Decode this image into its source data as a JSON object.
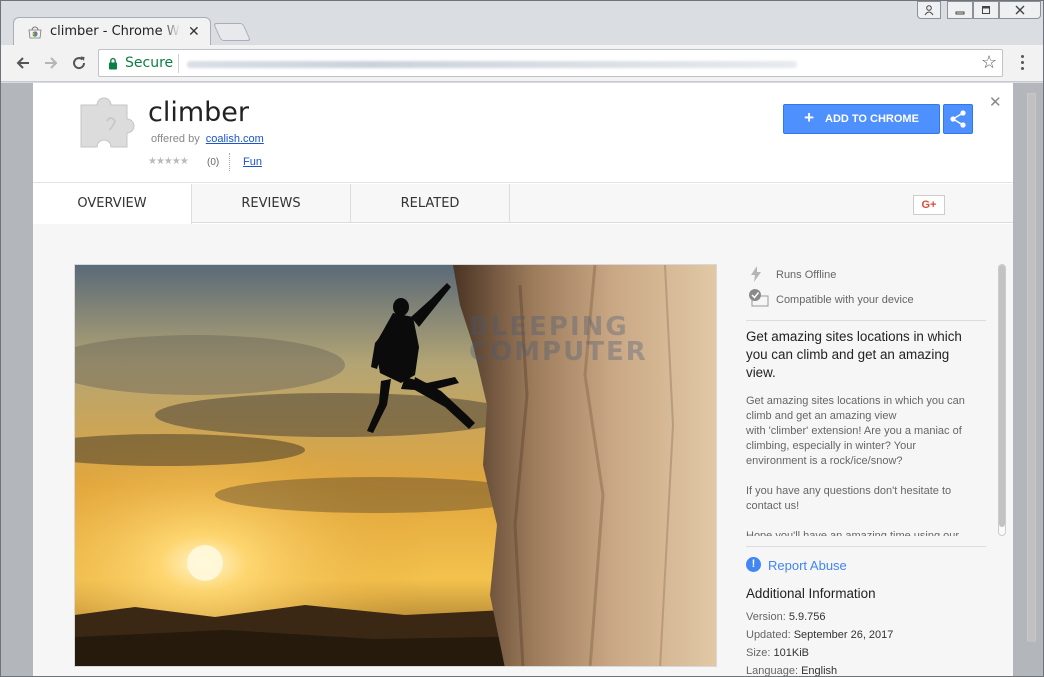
{
  "browser": {
    "tab_title": "climber - Chrome Web Store",
    "secure_label": "Secure"
  },
  "extension": {
    "name": "climber",
    "offered_by_label": "offered by",
    "publisher": "coalish.com",
    "rating_count": "(0)",
    "category": "Fun",
    "add_button_label": "ADD TO CHROME"
  },
  "tabs": [
    "OVERVIEW",
    "REVIEWS",
    "RELATED"
  ],
  "gplus_label": "G+",
  "features": [
    {
      "icon": "lightning-icon",
      "label": "Runs Offline"
    },
    {
      "icon": "device-check-icon",
      "label": "Compatible with your device"
    }
  ],
  "headline": "Get amazing sites locations in which you can climb and get an amazing view.",
  "description": "Get amazing sites locations in which you can climb and get an amazing view\nwith 'climber' extension! Are you a maniac of climbing, especially in winter? Your environment is a rock/ice/snow?\n\nIf you have any questions don't hesitate to contact us!\n\nHope you'll have an amazing time using our",
  "report_abuse": "Report Abuse",
  "additional_info": {
    "title": "Additional Information",
    "version_label": "Version:",
    "version": "5.9.756",
    "updated_label": "Updated:",
    "updated": "September 26, 2017",
    "size_label": "Size:",
    "size": "101KiB",
    "language_label": "Language:",
    "language": "English"
  },
  "watermark": "BLEEPING COMPUTER",
  "colors": {
    "accent": "#4d90fe",
    "link": "#1a55c9",
    "secure": "#0b8043"
  }
}
